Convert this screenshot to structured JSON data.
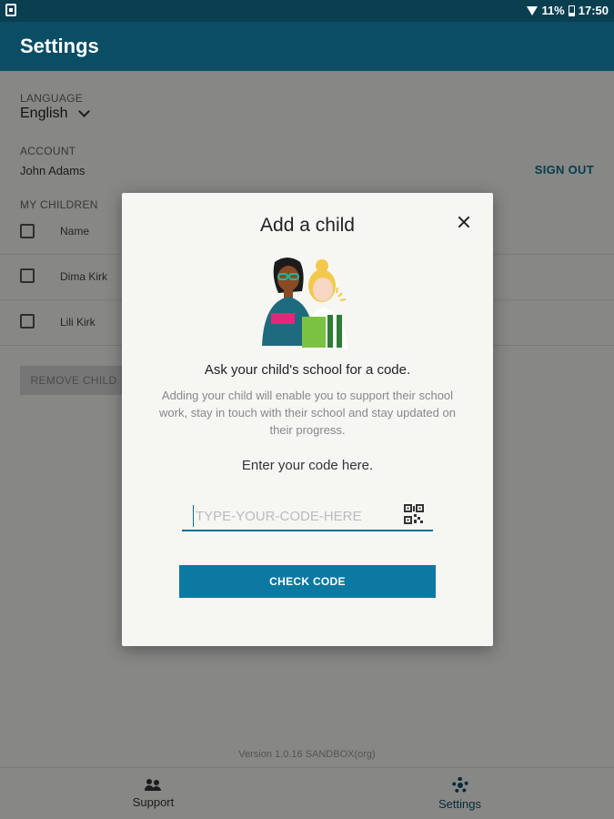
{
  "status_bar": {
    "battery": "11%",
    "time": "17:50"
  },
  "app_bar": {
    "title": "Settings"
  },
  "settings": {
    "language_label": "LANGUAGE",
    "language_value": "English",
    "account_label": "ACCOUNT",
    "account_name": "John Adams",
    "sign_out": "SIGN OUT",
    "children_label": "MY CHILDREN",
    "header_name": "Name",
    "children": [
      {
        "name": "Dima Kirk"
      },
      {
        "name": "Lili Kirk"
      }
    ],
    "remove_child": "REMOVE CHILD",
    "version": "Version 1.0.16 SANDBOX(org)"
  },
  "bottom_nav": {
    "items": [
      {
        "label": "Support",
        "icon": "support-icon",
        "active": false
      },
      {
        "label": "Settings",
        "icon": "gear-icon",
        "active": true
      }
    ]
  },
  "dialog": {
    "title": "Add a child",
    "prompt": "Ask your child's school for a code.",
    "description": "Adding your child will enable you to support their school work, stay in touch with their school and stay updated on their progress.",
    "enter_label": "Enter your code here.",
    "code_placeholder": "TYPE-YOUR-CODE-HERE",
    "code_value": "",
    "check_button": "CHECK CODE"
  },
  "colors": {
    "primary": "#0b4d64",
    "accent": "#0b79a1"
  }
}
